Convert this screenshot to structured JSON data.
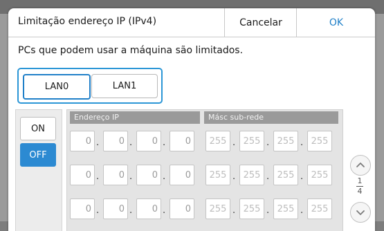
{
  "dialog": {
    "title": "Limitação endereço IP (IPv4)",
    "cancel_label": "Cancelar",
    "ok_label": "OK",
    "message": "PCs que podem usar a máquina são limitados."
  },
  "lan_tabs": [
    {
      "label": "LAN0",
      "selected": true
    },
    {
      "label": "LAN1",
      "selected": false
    }
  ],
  "toggle": {
    "on_label": "ON",
    "off_label": "OFF",
    "selected": "OFF"
  },
  "columns": {
    "ip_label": "Endereço IP",
    "mask_label": "Másc sub-rede"
  },
  "rows": [
    {
      "ip": [
        "0",
        "0",
        "0",
        "0"
      ],
      "mask": [
        "255",
        "255",
        "255",
        "255"
      ]
    },
    {
      "ip": [
        "0",
        "0",
        "0",
        "0"
      ],
      "mask": [
        "255",
        "255",
        "255",
        "255"
      ]
    },
    {
      "ip": [
        "0",
        "0",
        "0",
        "0"
      ],
      "mask": [
        "255",
        "255",
        "255",
        "255"
      ]
    }
  ],
  "pagination": {
    "current": "1",
    "total": "4"
  },
  "icons": {
    "scroll_up": "chevron-up-icon",
    "scroll_down": "chevron-down-icon"
  },
  "colors": {
    "accent": "#1f7fc8",
    "selected_toggle": "#2c8ad2",
    "group_border": "#2b96d6"
  }
}
